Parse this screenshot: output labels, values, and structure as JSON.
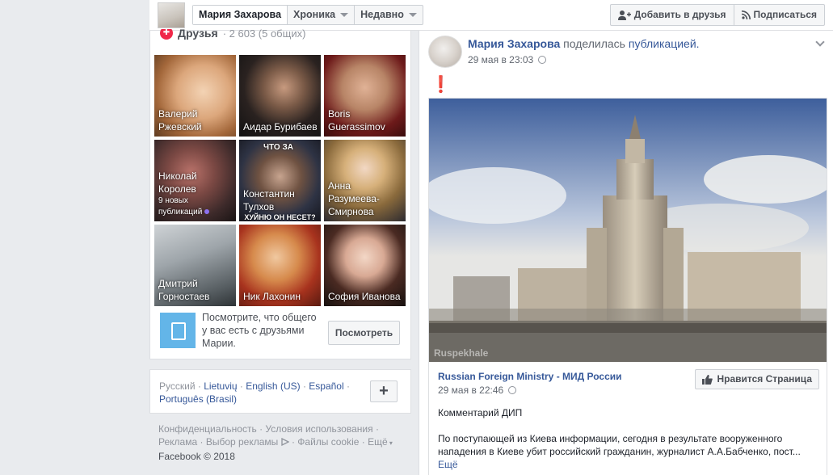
{
  "topbar": {
    "name": "Мария Захарова",
    "timeline": "Хроника",
    "recent": "Недавно",
    "add_friend": "Добавить в друзья",
    "follow": "Подписаться"
  },
  "friends": {
    "title": "Друзья",
    "count": "· 2 603 (5 общих)",
    "tiles": [
      {
        "name": "Валерий Ржевский"
      },
      {
        "name": "Аидар Бурибаев"
      },
      {
        "name": "Boris Guerassimov"
      },
      {
        "name": "Николай Королев",
        "sub": "9 новых публикаций"
      },
      {
        "name": "Константин Тулхов",
        "overlay_top": "ЧТО ЗА",
        "overlay_bottom": "ХУЙНЮ ОН НЕСЕТ?"
      },
      {
        "name": "Анна Разумеева-Смирнова"
      },
      {
        "name": "Дмитрий Горностаев"
      },
      {
        "name": "Ник Лахонин"
      },
      {
        "name": "София Иванова"
      }
    ],
    "mutual_text": "Посмотрите, что общего у вас есть с друзьями Марии.",
    "mutual_button": "Посмотреть"
  },
  "languages": {
    "current": "Русский",
    "links": [
      "Lietuvių",
      "English (US)",
      "Español",
      "Português (Brasil)"
    ]
  },
  "footer": {
    "links": [
      "Конфиденциальность",
      "Условия использования",
      "Реклама",
      "Выбор рекламы",
      "Файлы cookie",
      "Ещё"
    ],
    "copyright": "Facebook © 2018"
  },
  "post": {
    "author": "Мария Захарова",
    "action": "поделилась",
    "object": "публикацией.",
    "time": "29 мая в 23:03",
    "exclamation": "❗",
    "watermark": "Ruspekhale",
    "shared": {
      "page_name": "Russian Foreign Ministry - МИД России",
      "time": "29 мая в 22:46",
      "like_button": "Нравится Страница",
      "comment_label": "Комментарий ДИП",
      "body": "По поступающей из Киева информации, сегодня в результате вооруженного нападения в Киеве убит российский гражданин, журналист А.А.Бабченко, пост...",
      "more": "Ещё"
    }
  }
}
